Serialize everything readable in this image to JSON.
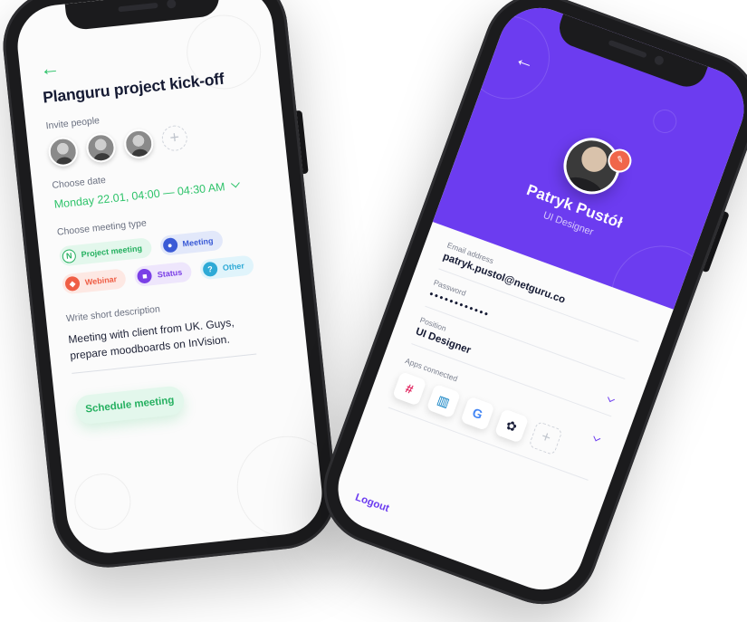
{
  "meeting_screen": {
    "back_arrow": "←",
    "title": "Planguru project kick-off",
    "invite_label": "Invite people",
    "add_person_symbol": "+",
    "date_label": "Choose date",
    "date_value": "Monday 22.01, 04:00 — 04:30 AM",
    "meeting_type_label": "Choose meeting type",
    "meeting_types": [
      {
        "label": "Project meeting",
        "icon": "N"
      },
      {
        "label": "Meeting",
        "icon": "●"
      },
      {
        "label": "Webinar",
        "icon": "◆"
      },
      {
        "label": "Status",
        "icon": "■"
      },
      {
        "label": "Other",
        "icon": "?"
      }
    ],
    "description_label": "Write short description",
    "description_value": "Meeting with client from UK. Guys, prepare moodboards on InVision.",
    "schedule_button": "Schedule meeting",
    "colors": {
      "accent": "#2ec36a",
      "title": "#151a33"
    }
  },
  "profile_screen": {
    "back_arrow": "←",
    "name": "Patryk Pustół",
    "role": "UI Designer",
    "email_label": "Email address",
    "email_value": "patryk.pustol@netguru.co",
    "password_label": "Password",
    "password_value": "••••••••••••",
    "position_label": "Position",
    "position_value": "UI Designer",
    "apps_label": "Apps connected",
    "apps": [
      {
        "name": "slack-icon",
        "glyph": "#",
        "color": "#e01e5a"
      },
      {
        "name": "trello-icon",
        "glyph": "▥",
        "color": "#0079bf"
      },
      {
        "name": "google-icon",
        "glyph": "G",
        "color": "#4285f4"
      },
      {
        "name": "flower-icon",
        "glyph": "✿",
        "color": "#1b1f3a"
      }
    ],
    "add_app_symbol": "+",
    "logout_label": "Logout",
    "colors": {
      "header": "#6c3cf0",
      "edit_badge": "#f0664a"
    }
  }
}
